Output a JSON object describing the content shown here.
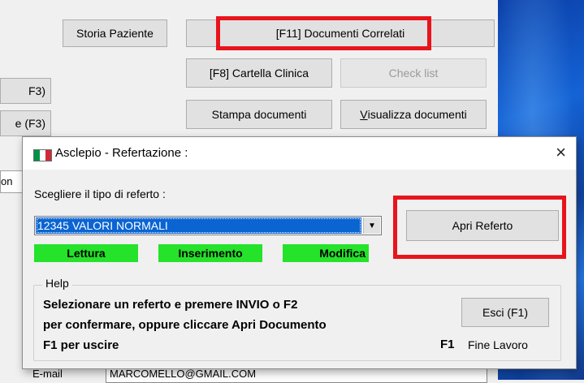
{
  "background": {
    "storia_button": "Storia Paziente",
    "documenti_button": "[F11] Documenti Correlati",
    "cartella_button": "[F8] Cartella Clinica",
    "checklist_button": "Check list",
    "stampa_button": "Stampa documenti",
    "visualizza_button_first": "V",
    "visualizza_button_rest": "isualizza documenti",
    "stub_f3": "F3)",
    "stub_ef3": "e (F3)",
    "stub_on": "on",
    "email_value": "MARCOMELLO@GMAIL.COM",
    "email_label": "E-mail"
  },
  "dialog": {
    "title": "Asclepio - Refertazione :",
    "close_icon": "×",
    "prompt": "Scegliere il tipo di referto :",
    "combo_value": "12345  VALORI NORMALI",
    "combo_arrow": "▼",
    "apri_referto": "Apri Referto",
    "mode_lettura": "Lettura",
    "mode_inserimento": "Inserimento",
    "mode_modifica": "Modifica",
    "help_legend": "Help",
    "help_line1": "Selezionare un referto e premere INVIO o F2",
    "help_line2": "per confermare, oppure cliccare Apri Documento",
    "help_line3": "F1 per uscire",
    "esci_button": "Esci (F1)",
    "f1_key": "F1",
    "f1_label": "Fine Lavoro"
  },
  "colors": {
    "highlight_box": "#e8141b",
    "mode_green": "#25e22a",
    "selection_blue": "#0a64d2"
  }
}
